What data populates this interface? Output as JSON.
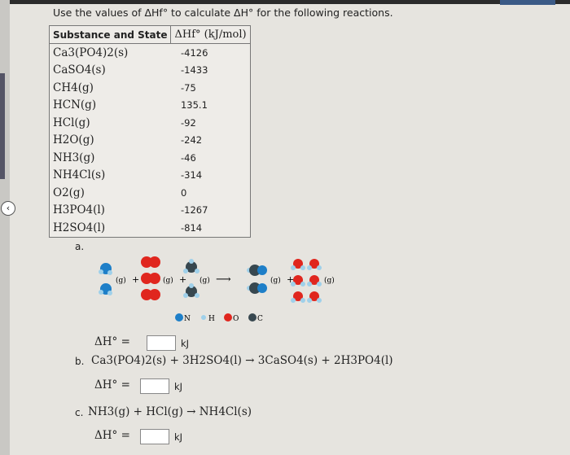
{
  "intro": "Use the values of ΔHf° to calculate ΔH° for the following reactions.",
  "table": {
    "headers": [
      "Substance and State",
      "ΔHf° (kJ/mol)"
    ],
    "rows": [
      [
        "Ca3(PO4)2(s)",
        "-4126"
      ],
      [
        "CaSO4(s)",
        "-1433"
      ],
      [
        "CH4(g)",
        "-75"
      ],
      [
        "HCN(g)",
        "135.1"
      ],
      [
        "HCl(g)",
        "-92"
      ],
      [
        "H2O(g)",
        "-242"
      ],
      [
        "NH3(g)",
        "-46"
      ],
      [
        "NH4Cl(s)",
        "-314"
      ],
      [
        "O2(g)",
        "0"
      ],
      [
        "H3PO4(l)",
        "-1267"
      ],
      [
        "H2SO4(l)",
        "-814"
      ]
    ]
  },
  "parts": {
    "a": {
      "label": "a.",
      "state": "(g)",
      "plus": "+",
      "arrow": "⟶",
      "legend": [
        "N",
        "H",
        "O",
        "C"
      ],
      "dh_label": "ΔH° =",
      "answer": "",
      "unit": "kJ"
    },
    "b": {
      "label": "b.",
      "equation": "Ca3(PO4)2(s) + 3H2SO4(l) → 3CaSO4(s) + 2H3PO4(l)",
      "dh_label": "ΔH° =",
      "answer": "",
      "unit": "kJ"
    },
    "c": {
      "label": "c.",
      "equation": "NH3(g) + HCl(g) → NH4Cl(s)",
      "dh_label": "ΔH° =",
      "answer": "",
      "unit": "kJ"
    }
  },
  "colors": {
    "N": "#1e7fc8",
    "H": "#9fd0ea",
    "O": "#e0261e",
    "C": "#37474f"
  }
}
